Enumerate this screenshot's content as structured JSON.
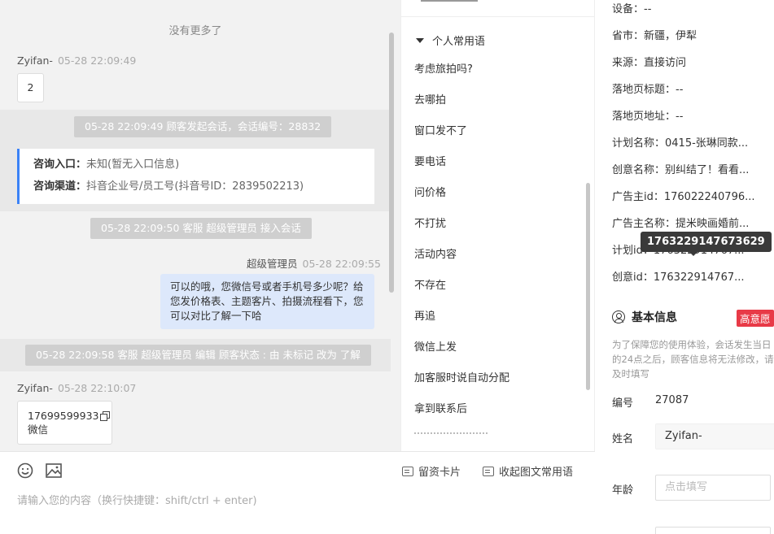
{
  "chat": {
    "no_more": "没有更多了",
    "messages": [
      {
        "sender": "Zyifan-",
        "time": "05-28 22:09:49",
        "text": "2"
      },
      {
        "system": "05-28 22:09:49 顾客发起会话，会话编号：28832"
      },
      {
        "system": "05-28 22:09:50 客服 超级管理员 接入会话"
      },
      {
        "sender": "超级管理员",
        "time": "05-28 22:09:55",
        "text": "可以的哦，您微信号或者手机号多少呢？给您发价格表、主题客片、拍摄流程看下，您可以对比了解一下哈"
      },
      {
        "system": "05-28 22:09:58 客服 超级管理员 编辑 顾客状态 : 由 未标记 改为 了解"
      },
      {
        "sender": "Zyifan-",
        "time": "05-28 22:10:07",
        "phone": "17699599933",
        "sub": "微信"
      }
    ],
    "info_card": {
      "entry_label": "咨询入口：",
      "entry_value": "未知(暂无入口信息)",
      "channel_label": "咨询渠道：",
      "channel_value": "抖音企业号/员工号(抖音号ID：2839502213)"
    }
  },
  "input": {
    "placeholder": "请输入您的内容（换行快捷键：shift/ctrl + enter)",
    "lead_card": "留资卡片",
    "collapse_phrases": "收起图文常用语",
    "icons": [
      "emoji-icon",
      "image-icon"
    ]
  },
  "phrases": {
    "group": "个人常用语",
    "items": [
      "考虑旅拍吗?",
      "去哪拍",
      "窗口发不了",
      "要电话",
      "问价格",
      "不打扰",
      "活动内容",
      "不存在",
      "再追",
      "微信上发",
      "加客服时说自动分配",
      "拿到联系后"
    ]
  },
  "profile": {
    "rows": [
      "设备：--",
      "省市：新疆，伊犁",
      "来源：直接访问",
      "落地页标题：--",
      "落地页地址：--",
      "计划名称：0415-张琳同款...",
      "创意名称：别纠结了！看看...",
      "广告主id：176022240796...",
      "广告主名称：提米映画婚前...",
      "计划id：176322914767...",
      "创意id：176322914767..."
    ],
    "tooltip": "1763229147673629",
    "basic_info_title": "基本信息",
    "intent_badge": "高意愿",
    "notice": "为了保障您的使用体验，会话发生当日的24点之后，顾客信息将无法修改，请及时填写",
    "number_label": "编号",
    "number_value": "27087",
    "name_label": "姓名",
    "name_value": "Zyifan-",
    "age_label": "年龄",
    "age_placeholder": "点击填写"
  }
}
